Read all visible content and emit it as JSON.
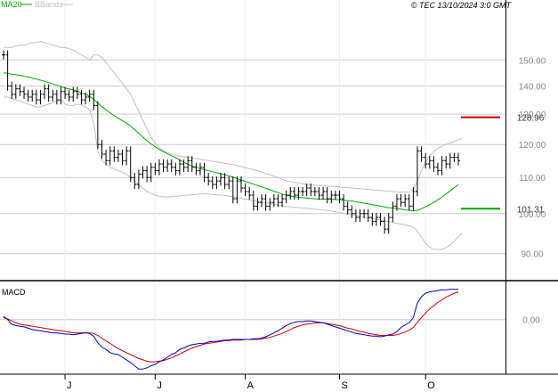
{
  "header": {
    "legend_ma": "MA20",
    "legend_bb": "BBands",
    "copyright": "© TEC 13/10/2024 3:0 GMT"
  },
  "colors": {
    "price": "#000000",
    "ma": "#00aa00",
    "bbands": "#c0c0c0",
    "macd": "#0000cc",
    "signal": "#cc0000",
    "resistance": "#cc0000",
    "support": "#00aa00",
    "grid": "#cccccc"
  },
  "macd_panel": {
    "title": "MACD",
    "zero_label": "0.00"
  },
  "chart_data": [
    {
      "type": "ohlc",
      "title": "",
      "y_scale": "log",
      "ylim": [
        84,
        170
      ],
      "y_ticks": [
        {
          "value": 90,
          "label": "90.00"
        },
        {
          "value": 100,
          "label": "100.00"
        },
        {
          "value": 110,
          "label": "110.00"
        },
        {
          "value": 120,
          "label": "120.00"
        },
        {
          "value": 130,
          "label": "130.00"
        },
        {
          "value": 140,
          "label": "140.00"
        },
        {
          "value": 150,
          "label": "150.00"
        }
      ],
      "x_ticks": [
        {
          "index": 15,
          "label": "J"
        },
        {
          "index": 37,
          "label": "J"
        },
        {
          "index": 59,
          "label": "A"
        },
        {
          "index": 82,
          "label": "S"
        },
        {
          "index": 103,
          "label": "O"
        }
      ],
      "x_count": 112,
      "closes": [
        152,
        140,
        137,
        139,
        138,
        137,
        136,
        137,
        135,
        137,
        139,
        136,
        137,
        135,
        138,
        137,
        136,
        138,
        137,
        135,
        136,
        137,
        133,
        120,
        117,
        115,
        118,
        116,
        117,
        115,
        118,
        110,
        108,
        111,
        112,
        110,
        113,
        112,
        114,
        113,
        114,
        113,
        112,
        114,
        113,
        115,
        113,
        112,
        113,
        110,
        109,
        108,
        109,
        110,
        108,
        109,
        104,
        109,
        107,
        106,
        105,
        102,
        103,
        104,
        102,
        103,
        104,
        103,
        104,
        105,
        106,
        105,
        106,
        106,
        107,
        106,
        106,
        105,
        106,
        104,
        105,
        105,
        104,
        102,
        101,
        100,
        99,
        100,
        100,
        99,
        98,
        99,
        98,
        96,
        99,
        102,
        104,
        103,
        104,
        102,
        106,
        118,
        116,
        114,
        115,
        113,
        112,
        115,
        114,
        116,
        116,
        115
      ],
      "series": [
        {
          "name": "MA20",
          "values": [
            145,
            144.8,
            144.5,
            144.3,
            144,
            143.7,
            143.4,
            143,
            142.6,
            142.2,
            141.8,
            141.3,
            140.8,
            140.3,
            139.8,
            139.3,
            139,
            138.6,
            138.1,
            137.5,
            137,
            136.3,
            135.2,
            133.9,
            132.6,
            131.5,
            130.5,
            129.5,
            128.6,
            127.8,
            127,
            126,
            124.8,
            123.6,
            122.4,
            121.2,
            120.2,
            119.3,
            118.5,
            117.8,
            117.1,
            116.5,
            115.9,
            115.2,
            114.5,
            113.9,
            113.4,
            113,
            112.6,
            112.3,
            112,
            111.7,
            111.4,
            111.1,
            110.8,
            110.5,
            110.1,
            109.7,
            109.3,
            108.9,
            108.5,
            108.1,
            107.7,
            107.3,
            106.9,
            106.5,
            106.1,
            105.7,
            105.3,
            105,
            104.8,
            104.6,
            104.4,
            104.3,
            104.2,
            104.1,
            104,
            103.9,
            103.9,
            103.9,
            103.9,
            103.8,
            103.7,
            103.6,
            103.5,
            103.4,
            103.2,
            103,
            102.8,
            102.6,
            102.4,
            102.2,
            102,
            101.8,
            101.6,
            101.5,
            101.4,
            101.2,
            101,
            100.9,
            100.7,
            100.9,
            101.3,
            101.8,
            102.4,
            103,
            103.7,
            104.5,
            105.3,
            106.2,
            107.1,
            108
          ]
        },
        {
          "name": "BBands upper",
          "values": [
            155,
            155,
            155,
            155.5,
            156,
            156,
            156.5,
            157,
            157,
            157.5,
            157,
            156.5,
            156,
            155.5,
            155,
            155,
            154.5,
            154,
            153,
            152,
            151,
            150,
            152,
            152,
            151,
            149,
            147,
            145,
            143,
            141,
            139,
            137,
            134,
            131,
            128,
            125,
            122.5,
            120.5,
            119,
            118,
            117.5,
            117,
            116.7,
            116.4,
            116.2,
            116,
            115.8,
            115.6,
            115.4,
            115.2,
            115,
            114.8,
            114.6,
            114.4,
            114.2,
            114,
            113.8,
            113.5,
            113.2,
            112.9,
            112.6,
            112.3,
            112,
            111.6,
            111.2,
            110.8,
            110.4,
            110,
            109.5,
            109,
            108.8,
            108.6,
            108.4,
            108.2,
            108,
            107.9,
            107.8,
            107.7,
            107.6,
            107.5,
            107.5,
            107.4,
            107.3,
            107.2,
            107.1,
            107,
            106.9,
            106.8,
            106.7,
            106.6,
            106.5,
            106.4,
            106.3,
            106.2,
            106.1,
            106,
            105.9,
            105.8,
            105.8,
            105.8,
            106.5,
            109,
            112,
            114.5,
            116.5,
            117.8,
            118.8,
            119.5,
            120,
            120.5,
            121,
            121.5,
            122
          ]
        },
        {
          "name": "BBands lower",
          "values": [
            136,
            136,
            135.5,
            135,
            134.5,
            134,
            133.5,
            133,
            132.5,
            132.5,
            133,
            133.5,
            134,
            134.5,
            135,
            133.5,
            133,
            133,
            133.5,
            133.2,
            132.5,
            131.5,
            127,
            118,
            115,
            114,
            113,
            112.5,
            112,
            111.5,
            111,
            110,
            109,
            108,
            107,
            106,
            105.5,
            105,
            104.7,
            104.5,
            104.5,
            104.6,
            104.7,
            104.8,
            104.9,
            105,
            105.1,
            105.2,
            105.3,
            105.3,
            105.3,
            105.2,
            105.1,
            105,
            104.9,
            104.7,
            104.5,
            104.3,
            104.1,
            103.9,
            103.7,
            103.5,
            103.3,
            103.1,
            102.9,
            102.7,
            102.5,
            102.3,
            102.1,
            101.9,
            101.8,
            101.7,
            101.6,
            101.5,
            101.4,
            101.3,
            101.2,
            101.1,
            101,
            100.9,
            100.7,
            100.5,
            100.3,
            100.1,
            99.9,
            99.7,
            99.5,
            99.3,
            99.1,
            98.9,
            98.7,
            98.5,
            98.3,
            98.1,
            97.9,
            97.7,
            97.5,
            97.3,
            97.1,
            96.9,
            96.5,
            95.5,
            94,
            92.5,
            91.5,
            91,
            91,
            91,
            91.5,
            92,
            93,
            94,
            95
          ]
        }
      ],
      "levels": [
        {
          "name": "resistance",
          "value": 128.96,
          "label": "128.96"
        },
        {
          "name": "support",
          "value": 101.31,
          "label": "101.31"
        }
      ]
    },
    {
      "type": "line",
      "title": "MACD",
      "ylim": [
        -8,
        5.5
      ],
      "y_ticks": [
        {
          "value": 0,
          "label": "0.00"
        }
      ],
      "series": [
        {
          "name": "MACD",
          "values": [
            0.5,
            0,
            -0.7,
            -0.9,
            -1,
            -1.1,
            -1.3,
            -1.5,
            -1.6,
            -1.7,
            -1.8,
            -1.9,
            -2,
            -2,
            -2.1,
            -2.2,
            -2.2,
            -2.3,
            -2.2,
            -2.1,
            -2,
            -2.1,
            -2.5,
            -3.5,
            -4.2,
            -4.5,
            -5,
            -5.2,
            -5.3,
            -5.7,
            -6.1,
            -6.5,
            -7,
            -7.5,
            -7.5,
            -7.3,
            -7,
            -6.8,
            -6.4,
            -6.1,
            -5.7,
            -5.3,
            -5,
            -4.5,
            -4.3,
            -4,
            -3.8,
            -3.7,
            -3.6,
            -3.6,
            -3.4,
            -3.3,
            -3.3,
            -3.2,
            -3.1,
            -3.1,
            -3,
            -3,
            -3,
            -3,
            -3,
            -2.9,
            -2.9,
            -2.8,
            -2.6,
            -2.3,
            -2,
            -1.7,
            -1.3,
            -0.9,
            -0.6,
            -0.4,
            -0.3,
            -0.3,
            -0.2,
            -0.2,
            -0.3,
            -0.4,
            -0.5,
            -0.7,
            -0.9,
            -1.1,
            -1.3,
            -1.5,
            -1.7,
            -1.9,
            -2.1,
            -2.2,
            -2.3,
            -2.4,
            -2.5,
            -2.5,
            -2.6,
            -2.5,
            -2.3,
            -2.2,
            -1.8,
            -1.2,
            -0.8,
            -0.5,
            0.3,
            2.5,
            3.5,
            4,
            4.2,
            4.3,
            4.4,
            4.5,
            4.5,
            4.6,
            4.6,
            4.6
          ]
        },
        {
          "name": "Signal",
          "values": [
            0.3,
            0.1,
            -0.2,
            -0.5,
            -0.7,
            -0.8,
            -0.9,
            -1,
            -1.1,
            -1.2,
            -1.3,
            -1.4,
            -1.5,
            -1.6,
            -1.7,
            -1.8,
            -1.9,
            -2,
            -2,
            -2,
            -2,
            -2,
            -2.1,
            -2.4,
            -2.8,
            -3.2,
            -3.6,
            -4,
            -4.4,
            -4.7,
            -5,
            -5.3,
            -5.6,
            -5.9,
            -6.1,
            -6.3,
            -6.4,
            -6.4,
            -6.3,
            -6.2,
            -6,
            -5.8,
            -5.5,
            -5.2,
            -4.9,
            -4.6,
            -4.3,
            -4.1,
            -3.9,
            -3.7,
            -3.6,
            -3.5,
            -3.4,
            -3.3,
            -3.2,
            -3.2,
            -3.1,
            -3.1,
            -3.1,
            -3,
            -3,
            -3,
            -3,
            -2.9,
            -2.8,
            -2.7,
            -2.5,
            -2.3,
            -2.1,
            -1.8,
            -1.5,
            -1.2,
            -1,
            -0.8,
            -0.7,
            -0.6,
            -0.5,
            -0.5,
            -0.5,
            -0.6,
            -0.7,
            -0.8,
            -0.9,
            -1.1,
            -1.3,
            -1.4,
            -1.6,
            -1.8,
            -1.9,
            -2.1,
            -2.2,
            -2.3,
            -2.4,
            -2.4,
            -2.4,
            -2.4,
            -2.3,
            -2.1,
            -1.9,
            -1.6,
            -1.2,
            -0.4,
            0.3,
            1,
            1.6,
            2.1,
            2.6,
            3,
            3.4,
            3.7,
            4,
            4.2
          ]
        }
      ]
    }
  ]
}
